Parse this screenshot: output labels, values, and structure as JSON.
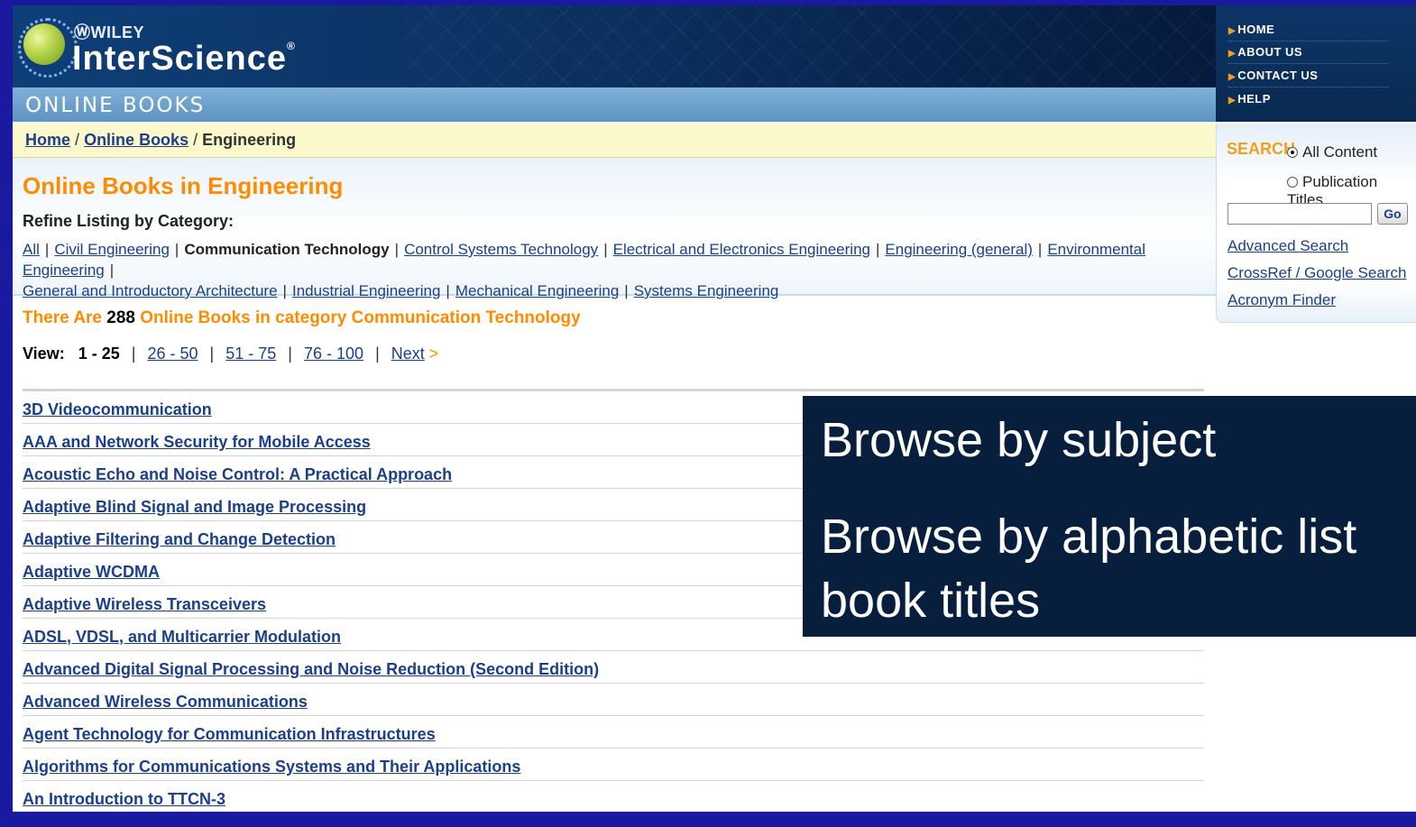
{
  "header": {
    "brand_top": "WILEY",
    "brand_name": "InterScience",
    "brand_reg": "®",
    "section": "ONLINE BOOKS"
  },
  "top_nav": [
    {
      "label": "HOME"
    },
    {
      "label": "ABOUT US"
    },
    {
      "label": "CONTACT US"
    },
    {
      "label": "HELP"
    }
  ],
  "breadcrumb": {
    "home": "Home",
    "sep1": "/",
    "online_books": "Online Books",
    "sep2": "/",
    "current": "Engineering"
  },
  "page_title": "Online Books in Engineering",
  "refine": {
    "label": "Refine Listing by Category:",
    "separator": "|",
    "categories": [
      {
        "label": "All"
      },
      {
        "label": "Civil Engineering"
      },
      {
        "label": "Communication Technology",
        "active": true
      },
      {
        "label": "Control Systems Technology"
      },
      {
        "label": "Electrical and Electronics Engineering"
      },
      {
        "label": "Engineering (general)"
      },
      {
        "label": "Environmental Engineering"
      },
      {
        "label": "General and Introductory Architecture"
      },
      {
        "label": "Industrial Engineering"
      },
      {
        "label": "Mechanical Engineering"
      },
      {
        "label": "Systems Engineering"
      }
    ]
  },
  "count": {
    "prefix": "There Are",
    "number": "288",
    "suffix": "Online Books in category Communication Technology"
  },
  "pagination": {
    "label": "View:",
    "current": "1 - 25",
    "pages": [
      "26 - 50",
      "51 - 75",
      "76 - 100"
    ],
    "next": "Next",
    "next_arrow": ">",
    "separator": "|"
  },
  "books": [
    "3D Videocommunication",
    "AAA and Network Security for Mobile Access",
    "Acoustic Echo and Noise Control: A Practical Approach",
    "Adaptive Blind Signal and Image Processing",
    "Adaptive Filtering and Change Detection",
    "Adaptive WCDMA",
    "Adaptive Wireless Transceivers",
    "ADSL, VDSL, and Multicarrier Modulation",
    "Advanced Digital Signal Processing and Noise Reduction (Second Edition)",
    "Advanced Wireless Communications",
    "Agent Technology for Communication Infrastructures",
    "Algorithms for Communications Systems and Their Applications",
    "An Introduction to TTCN-3"
  ],
  "search": {
    "title": "SEARCH",
    "option_all": "All Content",
    "option_titles": "Publication Titles",
    "selected": "All Content",
    "query_value": "",
    "go_label": "Go",
    "links": [
      "Advanced Search",
      "CrossRef / Google Search",
      "Acronym Finder"
    ]
  },
  "callout": {
    "line1": "Browse by subject",
    "line2": "Browse by alphabetic list",
    "line3": "book titles"
  },
  "colors": {
    "outer_border": "#1a1aa0",
    "title_orange": "#ff8c00",
    "link_blue": "#1b3f8b",
    "callout_bg": "#071e3d",
    "breadcrumb_bg": "#fbf9cc"
  }
}
